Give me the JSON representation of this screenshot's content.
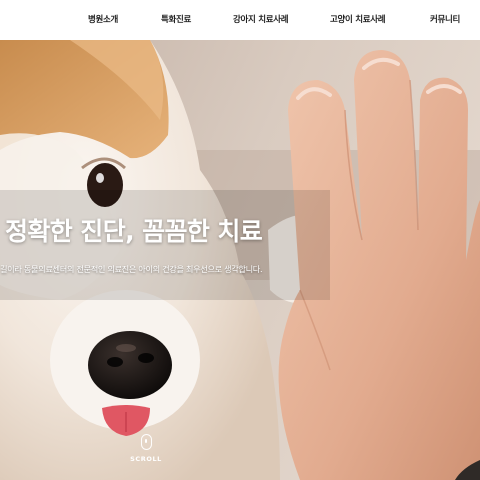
{
  "nav": {
    "items": [
      {
        "label": "병원소개"
      },
      {
        "label": "특화진료"
      },
      {
        "label": "강아지 치료사례"
      },
      {
        "label": "고양이 치료사례"
      },
      {
        "label": "커뮤니티"
      }
    ]
  },
  "hero": {
    "title": "정확한 진단, 꼼꼼한 치료",
    "subtitle": "길이라 동물의료센터의 전문적인 의료진은 아이의 건강을 최우선으로 생각합니다.",
    "scroll_label": "SCROLL",
    "photo_icon": "corgi-high-five-photo"
  },
  "colors": {
    "nav_bg": "#ffffff",
    "nav_text": "#222222",
    "hero_text": "#ffffff"
  }
}
